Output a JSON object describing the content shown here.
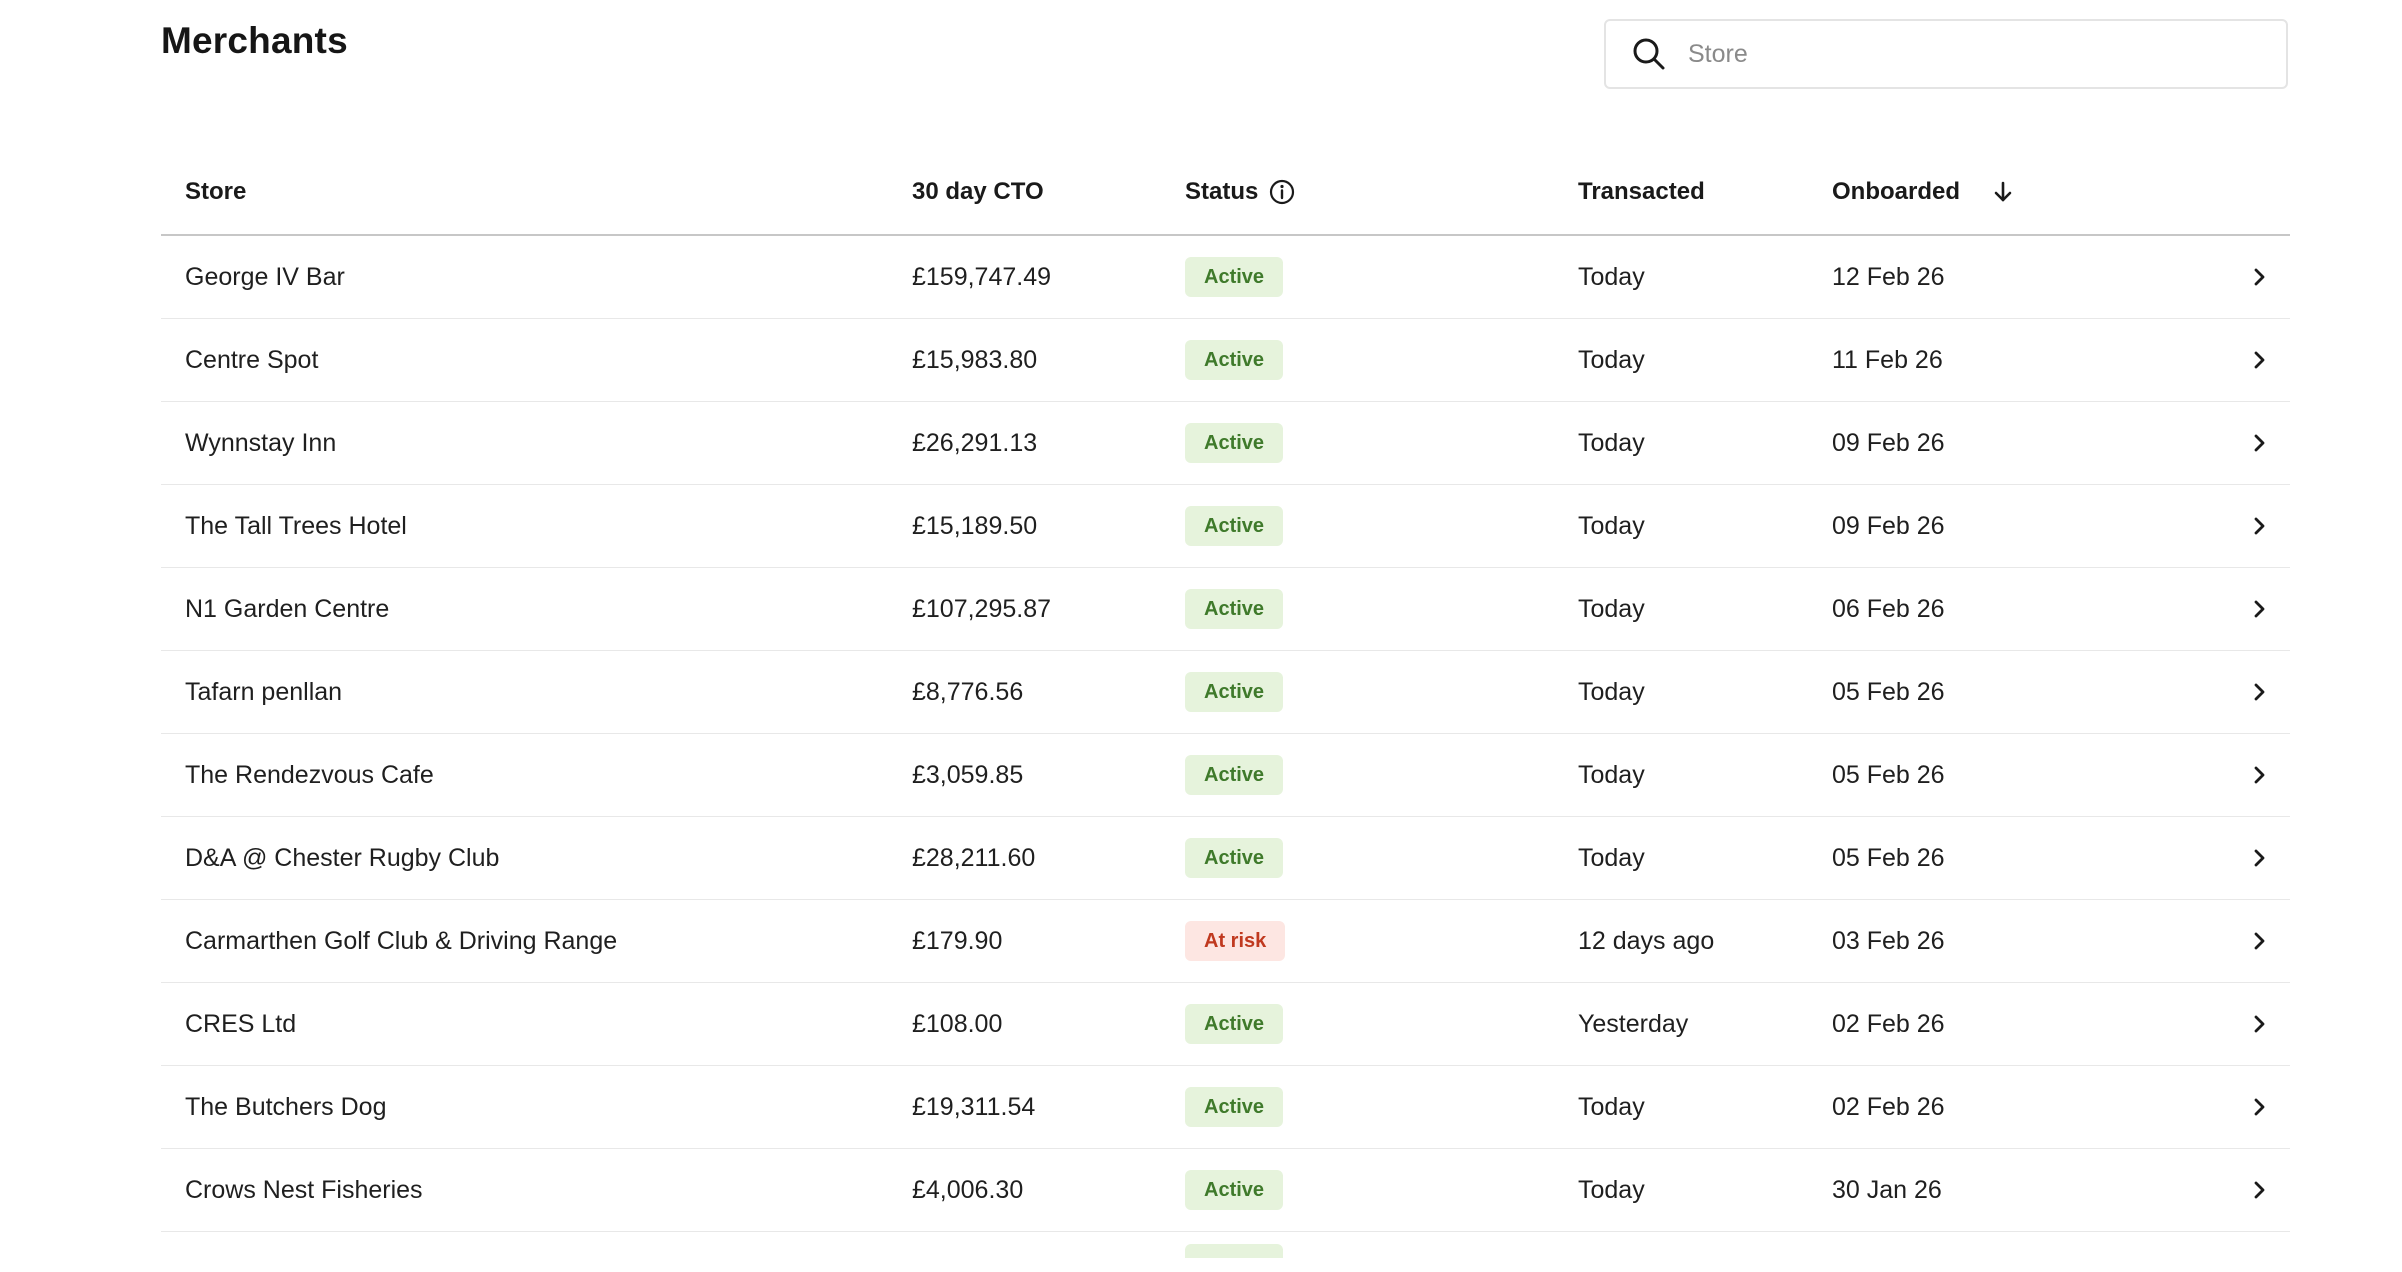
{
  "header": {
    "title": "Merchants"
  },
  "search": {
    "placeholder": "Store",
    "value": ""
  },
  "colors": {
    "active_bg": "#e6f3dc",
    "active_text": "#3f7a2b",
    "at_risk_bg": "#fde6e2",
    "at_risk_text": "#c0391f"
  },
  "table": {
    "columns": {
      "store": "Store",
      "cto": "30 day CTO",
      "status": "Status",
      "transacted": "Transacted",
      "onboarded": "Onboarded"
    },
    "sort": {
      "column": "Onboarded",
      "direction": "descending",
      "icon": "arrow-down-icon"
    },
    "rows": [
      {
        "store": "George IV Bar",
        "cto": "£159,747.49",
        "status": "Active",
        "status_kind": "active",
        "transacted": "Today",
        "onboarded": "12 Feb 26"
      },
      {
        "store": "Centre Spot",
        "cto": "£15,983.80",
        "status": "Active",
        "status_kind": "active",
        "transacted": "Today",
        "onboarded": "11 Feb 26"
      },
      {
        "store": "Wynnstay Inn",
        "cto": "£26,291.13",
        "status": "Active",
        "status_kind": "active",
        "transacted": "Today",
        "onboarded": "09 Feb 26"
      },
      {
        "store": "The Tall Trees Hotel",
        "cto": "£15,189.50",
        "status": "Active",
        "status_kind": "active",
        "transacted": "Today",
        "onboarded": "09 Feb 26"
      },
      {
        "store": "N1 Garden Centre",
        "cto": "£107,295.87",
        "status": "Active",
        "status_kind": "active",
        "transacted": "Today",
        "onboarded": "06 Feb 26"
      },
      {
        "store": "Tafarn penllan",
        "cto": "£8,776.56",
        "status": "Active",
        "status_kind": "active",
        "transacted": "Today",
        "onboarded": "05 Feb 26"
      },
      {
        "store": "The Rendezvous Cafe",
        "cto": "£3,059.85",
        "status": "Active",
        "status_kind": "active",
        "transacted": "Today",
        "onboarded": "05 Feb 26"
      },
      {
        "store": "D&A @ Chester Rugby Club",
        "cto": "£28,211.60",
        "status": "Active",
        "status_kind": "active",
        "transacted": "Today",
        "onboarded": "05 Feb 26"
      },
      {
        "store": "Carmarthen Golf Club & Driving Range",
        "cto": "£179.90",
        "status": "At risk",
        "status_kind": "at-risk",
        "transacted": "12 days ago",
        "onboarded": "03 Feb 26"
      },
      {
        "store": "CRES Ltd",
        "cto": "£108.00",
        "status": "Active",
        "status_kind": "active",
        "transacted": "Yesterday",
        "onboarded": "02 Feb 26"
      },
      {
        "store": "The Butchers Dog",
        "cto": "£19,311.54",
        "status": "Active",
        "status_kind": "active",
        "transacted": "Today",
        "onboarded": "02 Feb 26"
      },
      {
        "store": "Crows Nest Fisheries",
        "cto": "£4,006.30",
        "status": "Active",
        "status_kind": "active",
        "transacted": "Today",
        "onboarded": "30 Jan 26"
      }
    ]
  }
}
